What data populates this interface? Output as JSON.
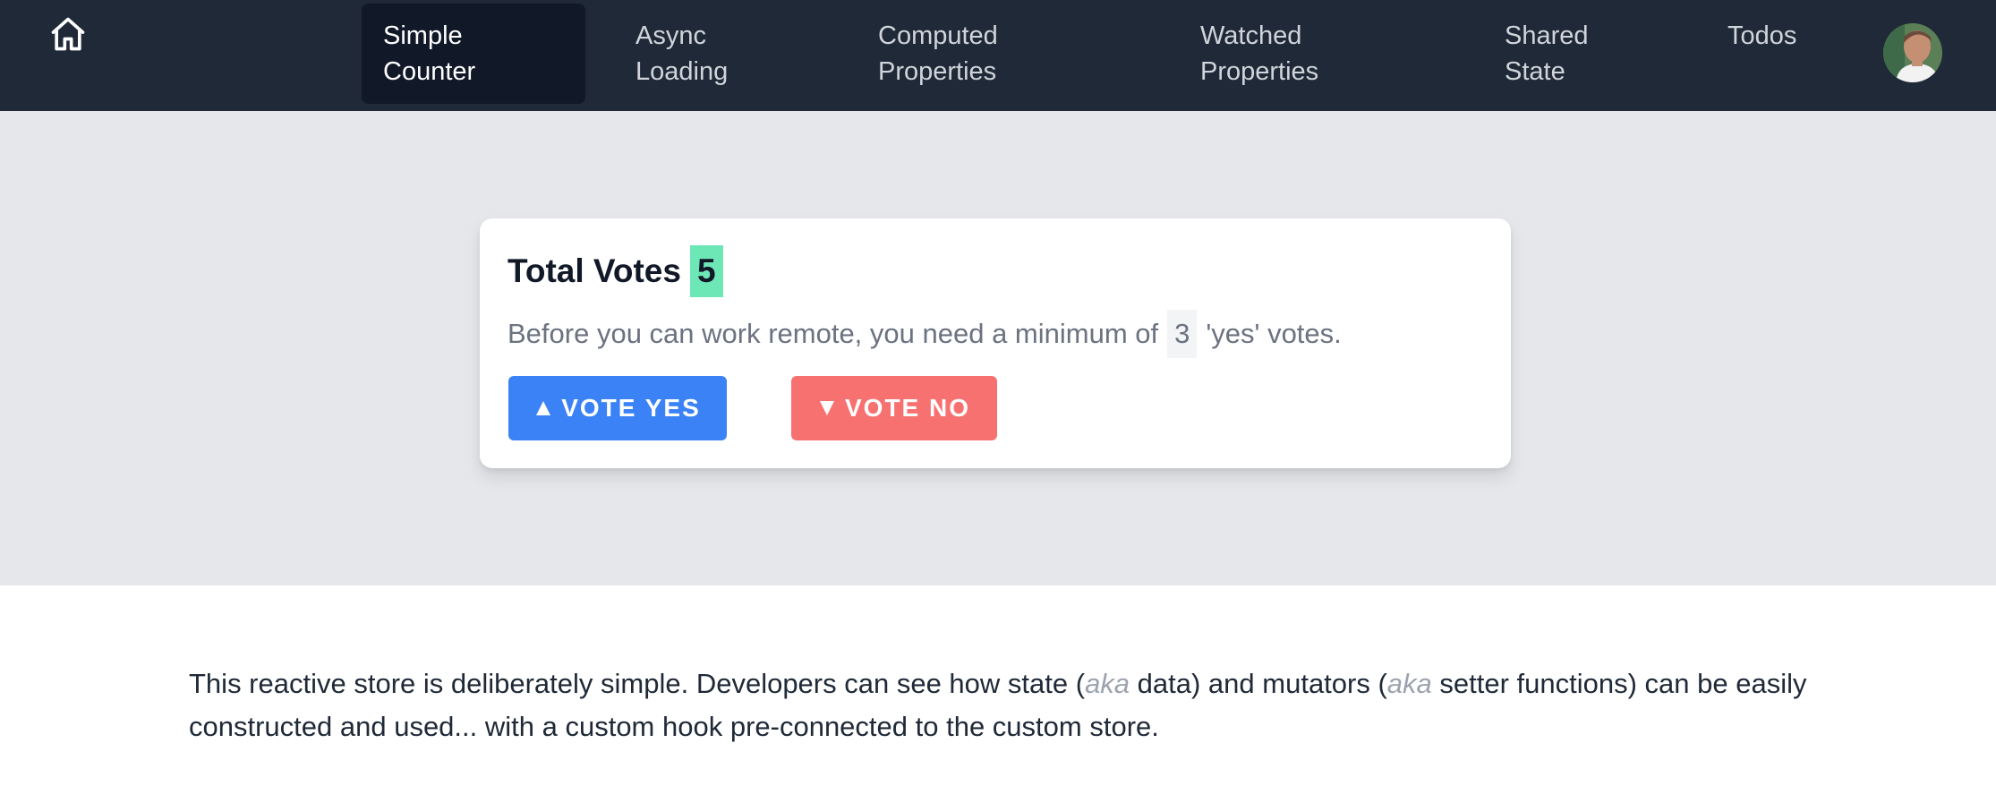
{
  "nav": {
    "items": [
      {
        "label": "Simple Counter",
        "line1": "Simple",
        "line2": "Counter",
        "active": true
      },
      {
        "label": "Async Loading",
        "line1": "Async",
        "line2": "Loading",
        "active": false
      },
      {
        "label": "Computed Properties",
        "line1": "Computed",
        "line2": "Properties",
        "active": false
      },
      {
        "label": "Watched Properties",
        "line1": "Watched",
        "line2": "Properties",
        "active": false
      },
      {
        "label": "Shared State",
        "line1": "Shared",
        "line2": "State",
        "active": false
      },
      {
        "label": "Todos",
        "line1": "Todos",
        "line2": "",
        "active": false
      }
    ],
    "home_icon": "home-icon",
    "avatar_icon": "user-avatar"
  },
  "card": {
    "title": "Total Votes",
    "count": "5",
    "desc_before": "Before you can work remote, you need a minimum of",
    "minimum": "3",
    "desc_after": "'yes' votes.",
    "yes_label": "VOTE YES",
    "no_label": "VOTE NO",
    "yes_icon": "triangle-up-icon",
    "no_icon": "triangle-down-icon"
  },
  "about": {
    "p1": "This reactive store is deliberately simple. Developers can see how state (",
    "aka1": "aka",
    "p2": " data) and mutators (",
    "aka2": "aka",
    "p3": " setter functions) can be easily constructed and used... with a custom hook pre-connected to the custom store."
  },
  "colors": {
    "nav_bg": "#1f2937",
    "nav_active_bg": "#111827",
    "hero_bg": "#e5e7eb",
    "count_bg": "#6ee7b7",
    "yes_bg": "#3b82f6",
    "no_bg": "#f87171"
  }
}
